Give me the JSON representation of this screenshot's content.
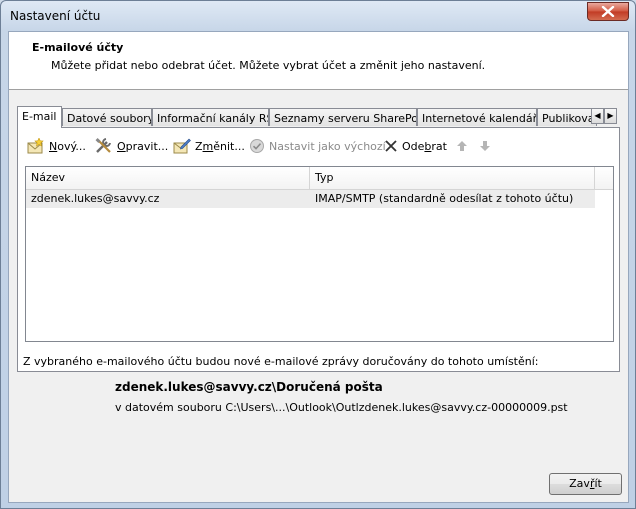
{
  "window": {
    "title": "Nastavení účtu"
  },
  "header": {
    "title": "E-mailové účty",
    "description": "Můžete přidat nebo odebrat účet. Můžete vybrat účet a změnit jeho nastavení."
  },
  "tabs": [
    {
      "label": "E-mail",
      "active": true
    },
    {
      "label": "Datové soubory"
    },
    {
      "label": "Informační kanály RSS"
    },
    {
      "label": "Seznamy serveru SharePoint"
    },
    {
      "label": "Internetové kalendáře"
    },
    {
      "label": "Publikovan"
    }
  ],
  "toolbar": {
    "new": {
      "pre": "",
      "key": "N",
      "post": "ový..."
    },
    "repair": {
      "pre": "",
      "key": "O",
      "post": "pravit..."
    },
    "change": {
      "pre": "Z",
      "key": "m",
      "post": "ěnit..."
    },
    "set_default": {
      "label": "Nastavit jako výchozí"
    },
    "remove": {
      "pre": "Ode",
      "key": "b",
      "post": "rat"
    }
  },
  "list": {
    "columns": [
      "Název",
      "Typ"
    ],
    "rows": [
      {
        "name": "zdenek.lukes@savvy.cz",
        "type": "IMAP/SMTP (standardně odesílat z tohoto účtu)"
      }
    ]
  },
  "delivery": {
    "text": "Z vybraného e-mailového účtu budou nové e-mailové zprávy doručovány do tohoto umístění:",
    "path": "zdenek.lukes@savvy.cz\\Doručená pošta",
    "file": "v datovém souboru C:\\Users\\...\\Outlook\\Outlzdenek.lukes@savvy.cz-00000009.pst"
  },
  "footer": {
    "close": {
      "pre": "Zav",
      "key": "ř",
      "post": "ít"
    }
  }
}
